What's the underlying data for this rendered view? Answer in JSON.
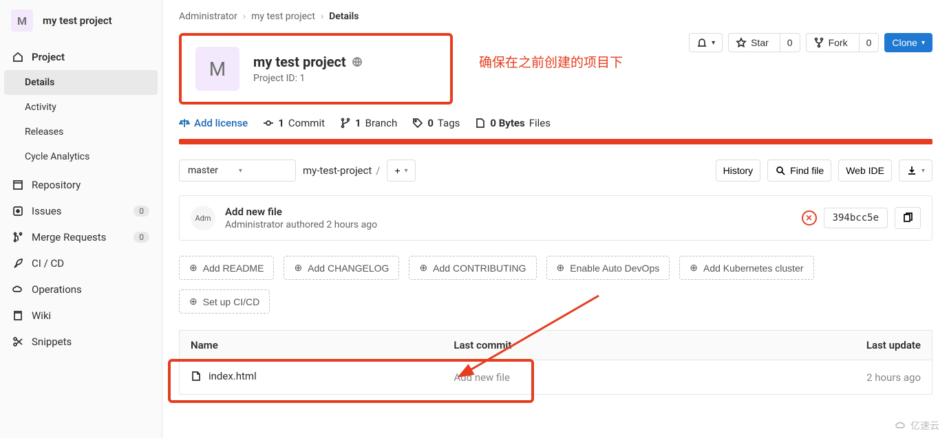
{
  "sidebar": {
    "avatar_letter": "M",
    "project_name": "my test project",
    "project_group": "Project",
    "items": {
      "details": "Details",
      "activity": "Activity",
      "releases": "Releases",
      "cycle": "Cycle Analytics",
      "repository": "Repository",
      "issues": "Issues",
      "issues_count": "0",
      "merge": "Merge Requests",
      "merge_count": "0",
      "cicd": "CI / CD",
      "operations": "Operations",
      "wiki": "Wiki",
      "snippets": "Snippets"
    }
  },
  "breadcrumb": {
    "root": "Administrator",
    "project": "my test project",
    "current": "Details"
  },
  "header": {
    "avatar_letter": "M",
    "title": "my test project",
    "project_id_label": "Project ID: 1",
    "annotation": "确保在之前创建的项目下"
  },
  "actions": {
    "star_label": "Star",
    "star_count": "0",
    "fork_label": "Fork",
    "fork_count": "0",
    "clone_label": "Clone"
  },
  "stats": {
    "add_license": "Add license",
    "commits_count": "1",
    "commits_label": "Commit",
    "branches_count": "1",
    "branches_label": "Branch",
    "tags_count": "0",
    "tags_label": "Tags",
    "size_count": "0 Bytes",
    "size_label": "Files"
  },
  "toolbar": {
    "branch": "master",
    "path": "my-test-project",
    "history": "History",
    "find_file": "Find file",
    "web_ide": "Web IDE"
  },
  "commit": {
    "avatar_text": "Adm",
    "title": "Add new file",
    "author": "Administrator authored",
    "time": "2 hours ago",
    "sha": "394bcc5e"
  },
  "add_buttons": {
    "readme": "Add README",
    "changelog": "Add CHANGELOG",
    "contributing": "Add CONTRIBUTING",
    "devops": "Enable Auto DevOps",
    "k8s": "Add Kubernetes cluster",
    "cicd": "Set up CI/CD"
  },
  "files": {
    "col_name": "Name",
    "col_commit": "Last commit",
    "col_update": "Last update",
    "rows": [
      {
        "name": "index.html",
        "commit": "Add new file",
        "update": "2 hours ago"
      }
    ]
  },
  "watermark": "亿速云"
}
